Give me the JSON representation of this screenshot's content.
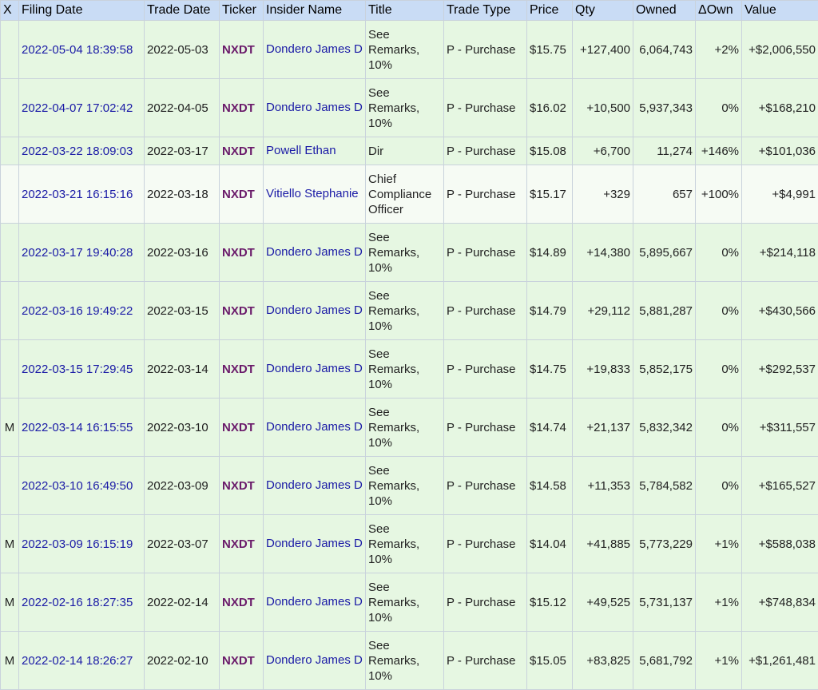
{
  "columns": [
    "X",
    "Filing Date",
    "Trade Date",
    "Ticker",
    "Insider Name",
    "Title",
    "Trade Type",
    "Price",
    "Qty",
    "Owned",
    "ΔOwn",
    "Value"
  ],
  "rows": [
    {
      "x": "",
      "filing": "2022-05-04 18:39:58",
      "trade": "2022-05-03",
      "ticker": "NXDT",
      "insider": "Dondero James D",
      "title": "See Remarks, 10%",
      "type": "P - Purchase",
      "price": "$15.75",
      "qty": "+127,400",
      "owned": "6,064,743",
      "down": "+2%",
      "value": "+$2,006,550"
    },
    {
      "x": "",
      "filing": "2022-04-07 17:02:42",
      "trade": "2022-04-05",
      "ticker": "NXDT",
      "insider": "Dondero James D",
      "title": "See Remarks, 10%",
      "type": "P - Purchase",
      "price": "$16.02",
      "qty": "+10,500",
      "owned": "5,937,343",
      "down": "0%",
      "value": "+$168,210"
    },
    {
      "x": "",
      "filing": "2022-03-22 18:09:03",
      "trade": "2022-03-17",
      "ticker": "NXDT",
      "insider": "Powell Ethan",
      "title": "Dir",
      "type": "P - Purchase",
      "price": "$15.08",
      "qty": "+6,700",
      "owned": "11,274",
      "down": "+146%",
      "value": "+$101,036"
    },
    {
      "x": "",
      "filing": "2022-03-21 16:15:16",
      "trade": "2022-03-18",
      "ticker": "NXDT",
      "insider": "Vitiello Stephanie",
      "title": "Chief Compliance Officer",
      "type": "P - Purchase",
      "price": "$15.17",
      "qty": "+329",
      "owned": "657",
      "down": "+100%",
      "value": "+$4,991"
    },
    {
      "x": "",
      "filing": "2022-03-17 19:40:28",
      "trade": "2022-03-16",
      "ticker": "NXDT",
      "insider": "Dondero James D",
      "title": "See Remarks, 10%",
      "type": "P - Purchase",
      "price": "$14.89",
      "qty": "+14,380",
      "owned": "5,895,667",
      "down": "0%",
      "value": "+$214,118"
    },
    {
      "x": "",
      "filing": "2022-03-16 19:49:22",
      "trade": "2022-03-15",
      "ticker": "NXDT",
      "insider": "Dondero James D",
      "title": "See Remarks, 10%",
      "type": "P - Purchase",
      "price": "$14.79",
      "qty": "+29,112",
      "owned": "5,881,287",
      "down": "0%",
      "value": "+$430,566"
    },
    {
      "x": "",
      "filing": "2022-03-15 17:29:45",
      "trade": "2022-03-14",
      "ticker": "NXDT",
      "insider": "Dondero James D",
      "title": "See Remarks, 10%",
      "type": "P - Purchase",
      "price": "$14.75",
      "qty": "+19,833",
      "owned": "5,852,175",
      "down": "0%",
      "value": "+$292,537"
    },
    {
      "x": "M",
      "filing": "2022-03-14 16:15:55",
      "trade": "2022-03-10",
      "ticker": "NXDT",
      "insider": "Dondero James D",
      "title": "See Remarks, 10%",
      "type": "P - Purchase",
      "price": "$14.74",
      "qty": "+21,137",
      "owned": "5,832,342",
      "down": "0%",
      "value": "+$311,557"
    },
    {
      "x": "",
      "filing": "2022-03-10 16:49:50",
      "trade": "2022-03-09",
      "ticker": "NXDT",
      "insider": "Dondero James D",
      "title": "See Remarks, 10%",
      "type": "P - Purchase",
      "price": "$14.58",
      "qty": "+11,353",
      "owned": "5,784,582",
      "down": "0%",
      "value": "+$165,527"
    },
    {
      "x": "M",
      "filing": "2022-03-09 16:15:19",
      "trade": "2022-03-07",
      "ticker": "NXDT",
      "insider": "Dondero James D",
      "title": "See Remarks, 10%",
      "type": "P - Purchase",
      "price": "$14.04",
      "qty": "+41,885",
      "owned": "5,773,229",
      "down": "+1%",
      "value": "+$588,038"
    },
    {
      "x": "M",
      "filing": "2022-02-16 18:27:35",
      "trade": "2022-02-14",
      "ticker": "NXDT",
      "insider": "Dondero James D",
      "title": "See Remarks, 10%",
      "type": "P - Purchase",
      "price": "$15.12",
      "qty": "+49,525",
      "owned": "5,731,137",
      "down": "+1%",
      "value": "+$748,834"
    },
    {
      "x": "M",
      "filing": "2022-02-14 18:26:27",
      "trade": "2022-02-10",
      "ticker": "NXDT",
      "insider": "Dondero James D",
      "title": "See Remarks, 10%",
      "type": "P - Purchase",
      "price": "$15.05",
      "qty": "+83,825",
      "owned": "5,681,792",
      "down": "+1%",
      "value": "+$1,261,481"
    }
  ]
}
